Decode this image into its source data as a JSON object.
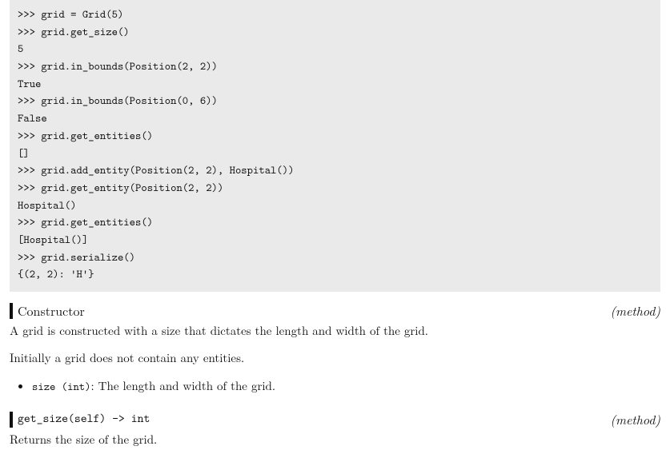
{
  "example": {
    "lines": [
      ">>> grid = Grid(5)",
      ">>> grid.get_size()",
      "5",
      ">>> grid.in_bounds(Position(2, 2))",
      "True",
      ">>> grid.in_bounds(Position(0, 6))",
      "False",
      ">>> grid.get_entities()",
      "[]",
      ">>> grid.add_entity(Position(2, 2), Hospital())",
      ">>> grid.get_entity(Position(2, 2))",
      "Hospital()",
      ">>> grid.get_entities()",
      "[Hospital()]",
      ">>> grid.serialize()",
      "{(2, 2): 'H'}"
    ]
  },
  "sections": [
    {
      "title": "Constructor",
      "title_mono": false,
      "tag": "(method)",
      "paragraphs": [
        "A grid is constructed with a size that dictates the length and width of the grid.",
        "Initially a grid does not contain any entities."
      ],
      "params": [
        {
          "sig": "size (int)",
          "colon": ": ",
          "desc": "The length and width of the grid."
        }
      ]
    },
    {
      "title": "get_size(self) -> int",
      "title_mono": true,
      "tag": "(method)",
      "paragraphs": [
        "Returns the size of the grid."
      ],
      "params": []
    }
  ]
}
